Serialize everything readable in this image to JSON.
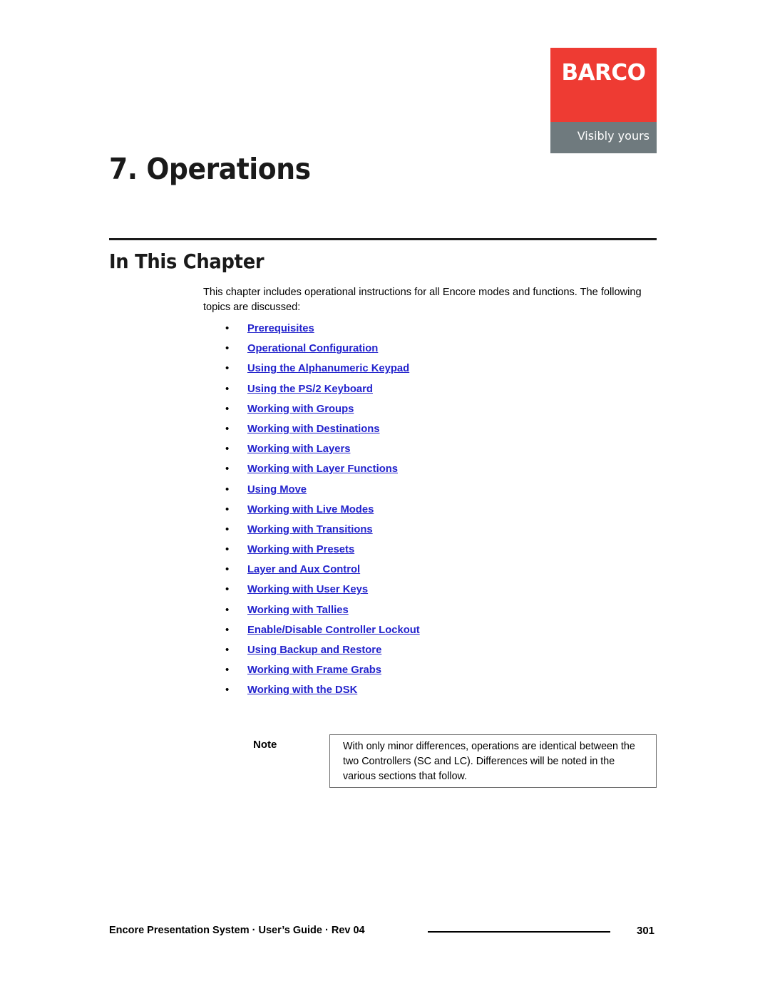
{
  "logo": {
    "wordmark": "BARCO",
    "tagline": "Visibly yours",
    "red": "#ee3b33",
    "gray": "#6f7a7e"
  },
  "chapter": {
    "title": "7. Operations"
  },
  "section": {
    "heading": "In This Chapter",
    "intro": "This chapter includes operational instructions for all Encore modes and functions.  The following topics are discussed:"
  },
  "topics": [
    {
      "bullet": "•",
      "label": "Prerequisites"
    },
    {
      "bullet": "•",
      "label": "Operational Configuration"
    },
    {
      "bullet": "•",
      "label": "Using the Alphanumeric Keypad"
    },
    {
      "bullet": "•",
      "label": "Using the PS/2 Keyboard"
    },
    {
      "bullet": "•",
      "label": "Working with Groups"
    },
    {
      "bullet": "•",
      "label": "Working with Destinations"
    },
    {
      "bullet": "•",
      "label": "Working with Layers"
    },
    {
      "bullet": "•",
      "label": "Working with Layer Functions"
    },
    {
      "bullet": "•",
      "label": "Using Move"
    },
    {
      "bullet": "•",
      "label": "Working with Live Modes"
    },
    {
      "bullet": "•",
      "label": "Working with Transitions"
    },
    {
      "bullet": "•",
      "label": "Working with Presets"
    },
    {
      "bullet": "•",
      "label": "Layer and Aux Control"
    },
    {
      "bullet": "•",
      "label": "Working with User Keys"
    },
    {
      "bullet": "•",
      "label": "Working with Tallies"
    },
    {
      "bullet": "•",
      "label": "Enable/Disable Controller Lockout"
    },
    {
      "bullet": "•",
      "label": "Using Backup and Restore"
    },
    {
      "bullet": "•",
      "label": "Working with Frame Grabs"
    },
    {
      "bullet": "•",
      "label": "Working with the DSK"
    }
  ],
  "note": {
    "label": "Note",
    "text": "With only minor differences, operations are identical between the two Controllers (SC and LC).  Differences will be noted in the various sections that follow."
  },
  "footer": {
    "text": "Encore Presentation System · User’s Guide · Rev 04",
    "page": "301"
  },
  "link_color": "#2222cc"
}
